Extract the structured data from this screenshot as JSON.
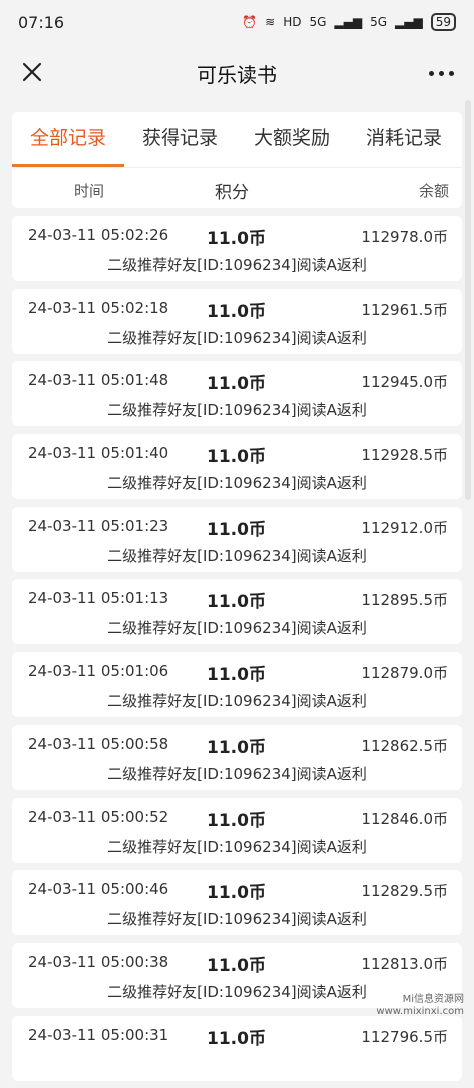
{
  "status": {
    "time": "07:16",
    "battery": "59",
    "net1": "5G",
    "net2": "5G",
    "hd": "HD"
  },
  "header": {
    "title": "可乐读书"
  },
  "tabs": [
    {
      "label": "全部记录",
      "active": true
    },
    {
      "label": "获得记录",
      "active": false
    },
    {
      "label": "大额奖励",
      "active": false
    },
    {
      "label": "消耗记录",
      "active": false
    }
  ],
  "columns": {
    "time": "时间",
    "points": "积分",
    "balance": "余额"
  },
  "records": [
    {
      "time": "24-03-11 05:02:26",
      "amount": "11.0币",
      "balance": "112978.0币",
      "desc": "二级推荐好友[ID:1096234]阅读A返利"
    },
    {
      "time": "24-03-11 05:02:18",
      "amount": "11.0币",
      "balance": "112961.5币",
      "desc": "二级推荐好友[ID:1096234]阅读A返利"
    },
    {
      "time": "24-03-11 05:01:48",
      "amount": "11.0币",
      "balance": "112945.0币",
      "desc": "二级推荐好友[ID:1096234]阅读A返利"
    },
    {
      "time": "24-03-11 05:01:40",
      "amount": "11.0币",
      "balance": "112928.5币",
      "desc": "二级推荐好友[ID:1096234]阅读A返利"
    },
    {
      "time": "24-03-11 05:01:23",
      "amount": "11.0币",
      "balance": "112912.0币",
      "desc": "二级推荐好友[ID:1096234]阅读A返利"
    },
    {
      "time": "24-03-11 05:01:13",
      "amount": "11.0币",
      "balance": "112895.5币",
      "desc": "二级推荐好友[ID:1096234]阅读A返利"
    },
    {
      "time": "24-03-11 05:01:06",
      "amount": "11.0币",
      "balance": "112879.0币",
      "desc": "二级推荐好友[ID:1096234]阅读A返利"
    },
    {
      "time": "24-03-11 05:00:58",
      "amount": "11.0币",
      "balance": "112862.5币",
      "desc": "二级推荐好友[ID:1096234]阅读A返利"
    },
    {
      "time": "24-03-11 05:00:52",
      "amount": "11.0币",
      "balance": "112846.0币",
      "desc": "二级推荐好友[ID:1096234]阅读A返利"
    },
    {
      "time": "24-03-11 05:00:46",
      "amount": "11.0币",
      "balance": "112829.5币",
      "desc": "二级推荐好友[ID:1096234]阅读A返利"
    },
    {
      "time": "24-03-11 05:00:38",
      "amount": "11.0币",
      "balance": "112813.0币",
      "desc": "二级推荐好友[ID:1096234]阅读A返利"
    },
    {
      "time": "24-03-11 05:00:31",
      "amount": "11.0币",
      "balance": "112796.5币",
      "desc": ""
    }
  ],
  "watermark": {
    "line1": "Mi信息资源网",
    "line2": "www.mixinxi.com"
  },
  "colors": {
    "accent": "#e85a20",
    "background": "#f3f3f3"
  }
}
